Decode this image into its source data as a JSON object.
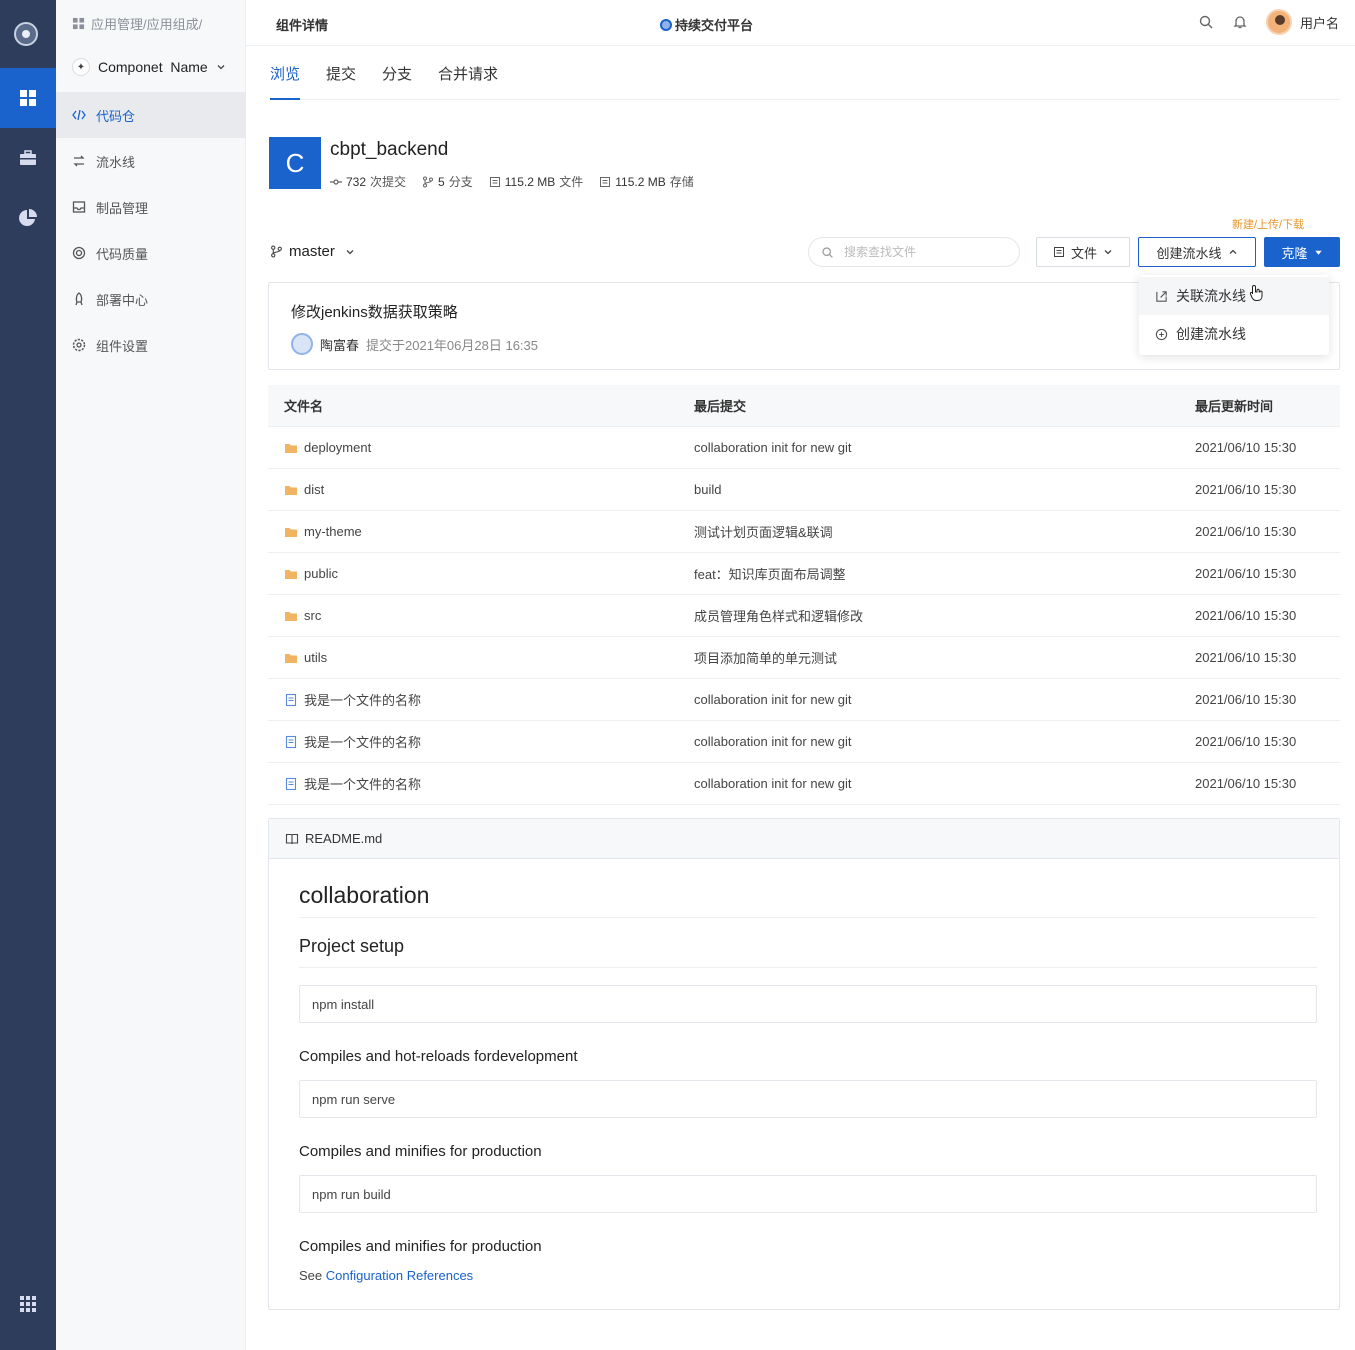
{
  "rail": {
    "items": [
      "logo",
      "apps-grid",
      "toolbox",
      "pie-chart",
      "app-launcher"
    ]
  },
  "subnav": {
    "breadcrumb": "应用管理/应用组成/",
    "component_name": "Componet  Name",
    "items": [
      {
        "label": "代码仓",
        "icon": "code-icon",
        "active": true
      },
      {
        "label": "流水线",
        "icon": "pipeline-icon",
        "active": false
      },
      {
        "label": "制品管理",
        "icon": "inbox-icon",
        "active": false
      },
      {
        "label": "代码质量",
        "icon": "quality-icon",
        "active": false
      },
      {
        "label": "部署中心",
        "icon": "rocket-icon",
        "active": false
      },
      {
        "label": "组件设置",
        "icon": "gear-icon",
        "active": false
      }
    ]
  },
  "header": {
    "page_title": "组件详情",
    "platform": "持续交付平台",
    "username": "用户名"
  },
  "tabs": [
    {
      "label": "浏览",
      "active": true
    },
    {
      "label": "提交",
      "active": false
    },
    {
      "label": "分支",
      "active": false
    },
    {
      "label": "合并请求",
      "active": false
    }
  ],
  "repo": {
    "avatar_letter": "C",
    "name": "cbpt_backend",
    "commits_count": "732",
    "commits_label": "次提交",
    "branches_count": "5",
    "branches_label": "分支",
    "files_size": "115.2 MB",
    "files_label": "文件",
    "storage_size": "115.2 MB",
    "storage_label": "存储"
  },
  "toolbar": {
    "branch": "master",
    "search_placeholder": "搜索查找文件",
    "file_button": "文件",
    "create_pipeline_button": "创建流水线",
    "clone_button": "克隆",
    "hint": "新建/上传/下载"
  },
  "dropdown": {
    "items": [
      "关联流水线",
      "创建流水线"
    ]
  },
  "commit": {
    "message": "修改jenkins数据获取策略",
    "author": "陶富春",
    "submitted": "提交于2021年06月28日 16:35"
  },
  "table": {
    "headers": [
      "文件名",
      "最后提交",
      "最后更新时间"
    ],
    "rows": [
      {
        "type": "folder",
        "name": "deployment",
        "commit": "collaboration init for new git",
        "time": "2021/06/10 15:30"
      },
      {
        "type": "folder",
        "name": "dist",
        "commit": "build",
        "time": "2021/06/10 15:30"
      },
      {
        "type": "folder",
        "name": "my-theme",
        "commit": "测试计划页面逻辑&联调",
        "time": "2021/06/10 15:30"
      },
      {
        "type": "folder",
        "name": "public",
        "commit": "feat：知识库页面布局调整",
        "time": "2021/06/10 15:30"
      },
      {
        "type": "folder",
        "name": "src",
        "commit": "成员管理角色样式和逻辑修改",
        "time": "2021/06/10 15:30"
      },
      {
        "type": "folder",
        "name": "utils",
        "commit": "项目添加简单的单元测试",
        "time": "2021/06/10 15:30"
      },
      {
        "type": "file",
        "name": "我是一个文件的名称",
        "commit": "collaboration init for new git",
        "time": "2021/06/10 15:30"
      },
      {
        "type": "file",
        "name": "我是一个文件的名称",
        "commit": "collaboration init for new git",
        "time": "2021/06/10 15:30"
      },
      {
        "type": "file",
        "name": "我是一个文件的名称",
        "commit": "collaboration init for new git",
        "time": "2021/06/10 15:30"
      }
    ]
  },
  "readme": {
    "filename": "README.md",
    "h1": "collaboration",
    "h2": "Project setup",
    "code1": "npm install",
    "h3_1": "Compiles and hot-reloads fordevelopment",
    "code2": "npm run serve",
    "h3_2": "Compiles and minifies for production",
    "code3": "npm run build",
    "h3_3": "Compiles and minifies for production",
    "see_prefix": "See",
    "see_link": "Configuration References"
  },
  "colors": {
    "primary": "#1a62cc",
    "rail_bg": "#2e3d5c",
    "hint": "#e8952c",
    "folder": "#f0b462"
  }
}
